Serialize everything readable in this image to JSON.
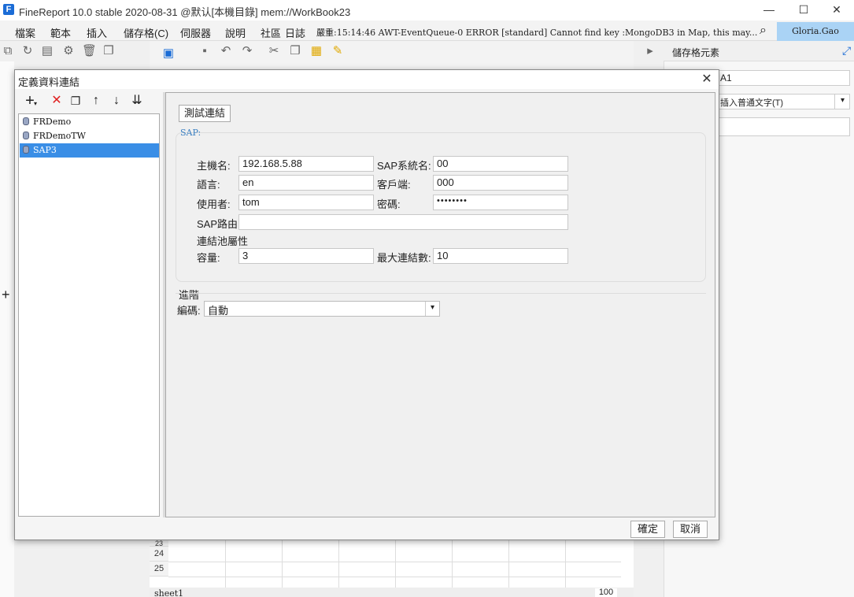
{
  "window": {
    "title": "FineReport 10.0 stable 2020-08-31 @默认[本機目錄]    mem://WorkBook23",
    "minimize": "—",
    "maximize": "☐",
    "close": "✕"
  },
  "menu": {
    "items": [
      "檔案",
      "範本",
      "插入",
      "儲存格(C)",
      "伺服器",
      "說明",
      "社區",
      "日誌"
    ],
    "log": "嚴重:15:14:46 AWT-EventQueue-0 ERROR [standard] Cannot find key :MongoDB3 in Map, this may...",
    "user": "Gloria.Gao"
  },
  "right_panel": {
    "title": "儲存格元素",
    "cell_name": "A1",
    "insert_text": "插入普通文字(T)"
  },
  "sheet": {
    "rows": [
      "23",
      "24",
      "25"
    ],
    "tab": "sheet1",
    "zoom": "100"
  },
  "dialog": {
    "title": "定義資料連結",
    "connections": [
      {
        "name": "FRDemo"
      },
      {
        "name": "FRDemoTW"
      },
      {
        "name": "SAP3"
      }
    ],
    "selected_index": 2,
    "test_button": "測試連結",
    "section_title": "SAP:",
    "labels": {
      "host": "主機名:",
      "sap_system": "SAP系統名:",
      "language": "語言:",
      "client": "客戶端:",
      "user": "使用者:",
      "password": "密碼:",
      "router": "SAP路由:",
      "pool": "連結池屬性",
      "capacity": "容量:",
      "max_conn": "最大連結數:"
    },
    "values": {
      "host": "192.168.5.88",
      "sap_system": "00",
      "language": "en",
      "client": "000",
      "user": "tom",
      "password": "••••••••",
      "router": "",
      "capacity": "3",
      "max_conn": "10"
    },
    "advanced": {
      "title": "進階",
      "encoding_label": "編碼:",
      "encoding_value": "自動"
    },
    "ok_button": "確定",
    "cancel_button": "取消"
  }
}
